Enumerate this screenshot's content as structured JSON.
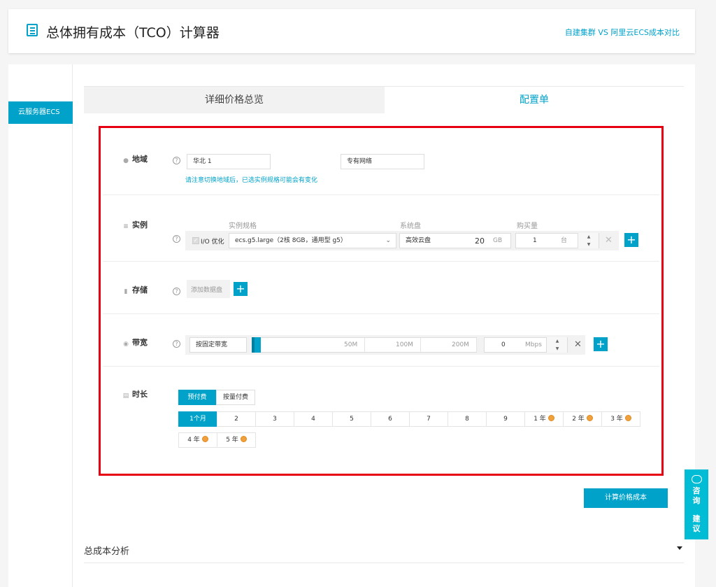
{
  "header": {
    "title": "总体拥有成本（TCO）计算器",
    "compare_link": "自建集群 VS 阿里云ECS成本对比"
  },
  "sidenav": {
    "items": [
      {
        "label": "云服务器ECS"
      }
    ]
  },
  "tabs": [
    {
      "label": "详细价格总览",
      "active": false
    },
    {
      "label": "配置单",
      "active": true
    }
  ],
  "region": {
    "label": "地域",
    "help": "?",
    "value": "华北 1",
    "network": "专有网络",
    "hint": "请注意切换地域后，已选实例规格可能会有变化"
  },
  "instance": {
    "label": "实例",
    "help": "?",
    "columns": {
      "spec": "实例规格",
      "disk": "系统盘",
      "qty": "购买量"
    },
    "io_opt_label": "I/O 优化",
    "spec_value": "ecs.g5.large（2核 8GB，通用型 g5）",
    "disk_type": "高效云盘",
    "disk_size": "20",
    "disk_unit": "GB",
    "quantity": "1",
    "quantity_unit": "台"
  },
  "storage": {
    "label": "存储",
    "help": "?",
    "add_disk_label": "添加数据盘"
  },
  "bandwidth": {
    "label": "带宽",
    "help": "?",
    "type": "按固定带宽",
    "marks": [
      "50M",
      "100M",
      "200M"
    ],
    "value": "0",
    "unit": "Mbps"
  },
  "duration": {
    "label": "时长",
    "pay_modes": [
      {
        "label": "预付费",
        "active": true
      },
      {
        "label": "按量付费",
        "active": false
      }
    ],
    "row1": [
      {
        "label": "1个月",
        "active": true,
        "gift": false
      },
      {
        "label": "2",
        "active": false,
        "gift": false
      },
      {
        "label": "3",
        "active": false,
        "gift": false
      },
      {
        "label": "4",
        "active": false,
        "gift": false
      },
      {
        "label": "5",
        "active": false,
        "gift": false
      },
      {
        "label": "6",
        "active": false,
        "gift": false
      },
      {
        "label": "7",
        "active": false,
        "gift": false
      },
      {
        "label": "8",
        "active": false,
        "gift": false
      },
      {
        "label": "9",
        "active": false,
        "gift": false
      },
      {
        "label": "1 年",
        "active": false,
        "gift": true
      },
      {
        "label": "2 年",
        "active": false,
        "gift": true
      },
      {
        "label": "3 年",
        "active": false,
        "gift": true
      }
    ],
    "row2": [
      {
        "label": "4 年",
        "active": false,
        "gift": true
      },
      {
        "label": "5 年",
        "active": false,
        "gift": true
      }
    ]
  },
  "actions": {
    "calculate_label": "计算价格成本"
  },
  "analysis": {
    "label": "总成本分析"
  },
  "float_panel": {
    "consult": [
      "咨",
      "询"
    ],
    "suggest": [
      "建",
      "议"
    ]
  },
  "colors": {
    "accent": "#00a2ca",
    "highlight_border": "#e60012",
    "gift": "#f0a03c"
  }
}
